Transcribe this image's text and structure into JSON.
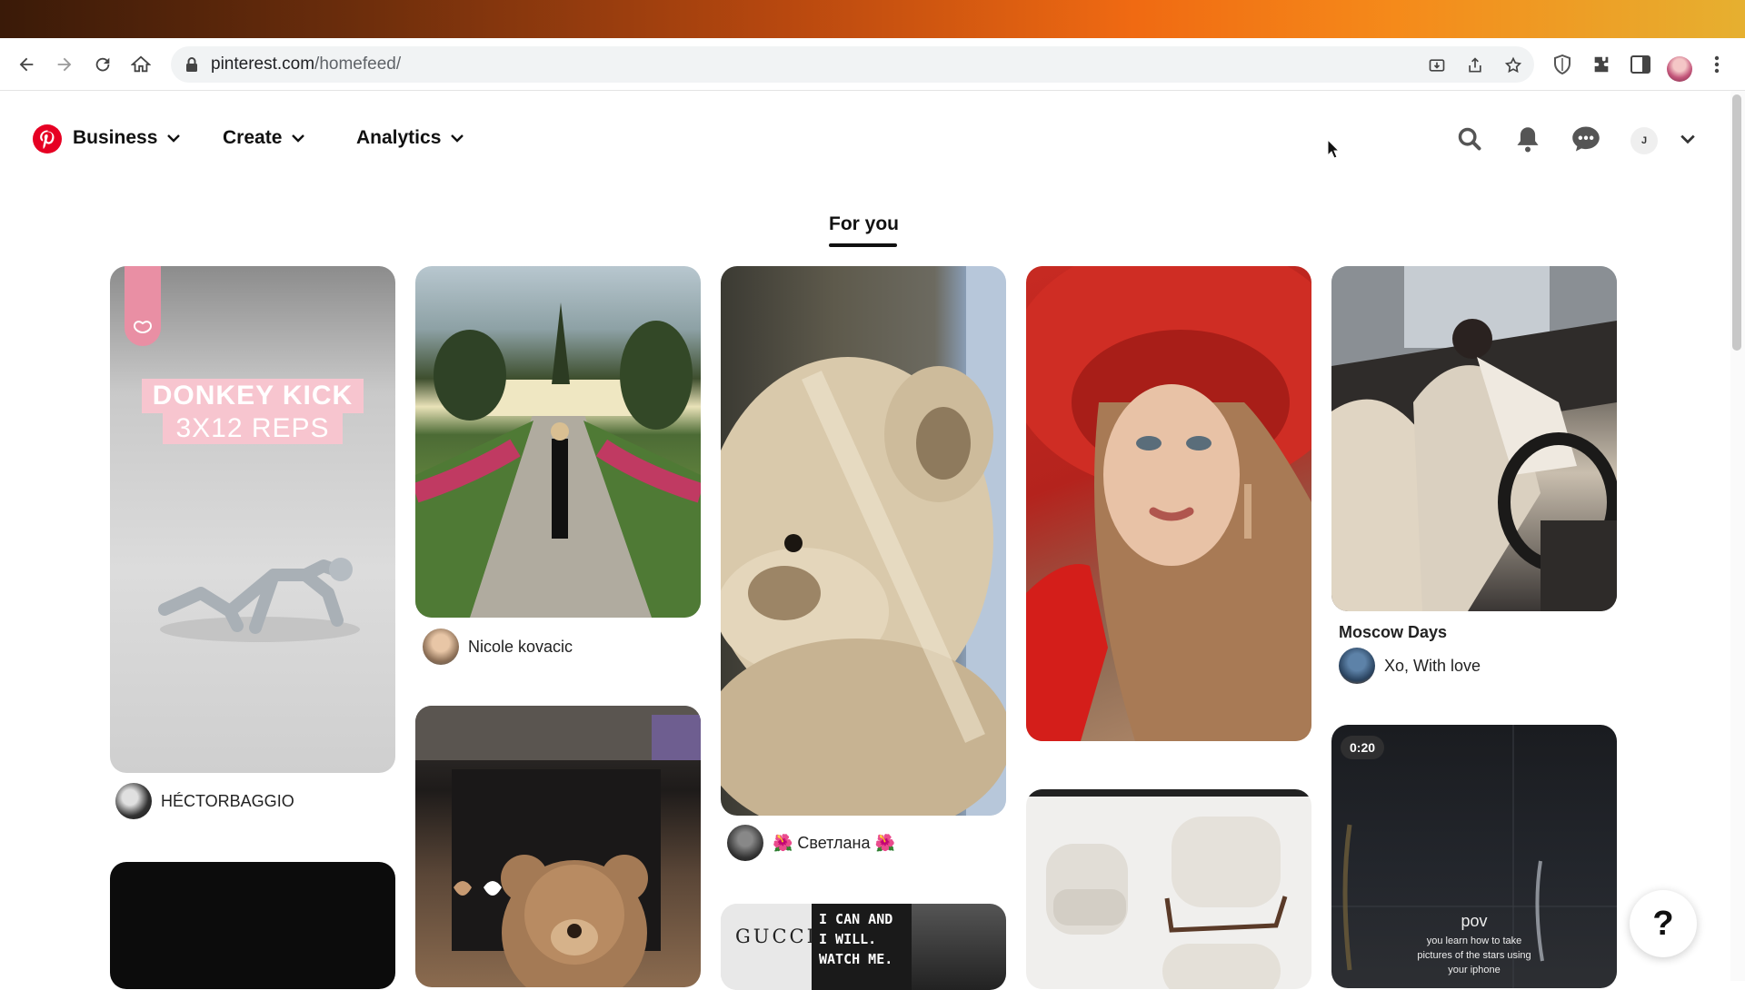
{
  "browser": {
    "url_host": "pinterest.com",
    "url_path": "/homefeed/"
  },
  "header": {
    "menus": [
      {
        "label": "Business"
      },
      {
        "label": "Create"
      },
      {
        "label": "Analytics"
      }
    ],
    "account_initial": "J"
  },
  "tabs": {
    "active": "For you"
  },
  "pins": {
    "donkey": {
      "line1": "DONKEY KICK",
      "line2": "3X12 REPS",
      "author": "HÉCTORBAGGIO"
    },
    "garden": {
      "author": "Nicole kovacic"
    },
    "bear": {
      "author": "🌺 Светлана 🌺"
    },
    "gucci": {
      "brand": "GUCCI",
      "quote_line1": "I CAN AND",
      "quote_line2": "I WILL.",
      "quote_line3": "WATCH ME."
    },
    "car": {
      "title": "Moscow Days",
      "author": "Xo, With love"
    },
    "video": {
      "duration": "0:20",
      "caption_title": "pov",
      "caption_line1": "you learn how to take",
      "caption_line2": "pictures of the stars using",
      "caption_line3": "your iphone"
    }
  },
  "help": {
    "label": "?"
  },
  "colors": {
    "pinterest_red": "#e60023",
    "active_text": "#111111"
  }
}
